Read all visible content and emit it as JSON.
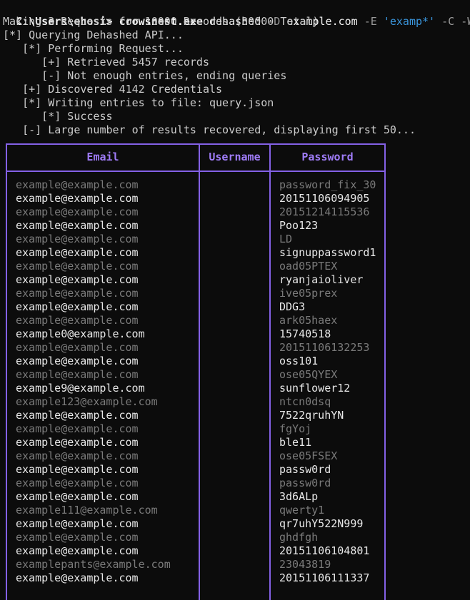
{
  "terminal": {
    "prompt": "C:\\Users\\ehosi>",
    "command": {
      "exe": "crowsnest.exe",
      "sub": "dehashed",
      "flag_d": "-D",
      "domain": "example.com",
      "flag_e": "-E",
      "query": "'examp*'",
      "flag_c": "-C",
      "flag_w": "-W"
    },
    "output": [
      "Making 3 Requests for 10000 Records (30000 Total)",
      "[*] Querying Dehashed API...",
      "   [*] Performing Request...",
      "      [+] Retrieved 5457 records",
      "      [-] Not enough entries, ending queries",
      "   [+] Discovered 4142 Credentials",
      "   [*] Writing entries to file: query.json",
      "      [*] Success",
      "   [-] Large number of results recovered, displaying first 50..."
    ]
  },
  "table": {
    "headers": [
      "Email",
      "Username",
      "Password"
    ],
    "border_color": "#8461e6",
    "header_color": "#9f7cf7",
    "rows": [
      {
        "email": "example@example.com",
        "username": "",
        "password": "password_fix_30",
        "style": "dim"
      },
      {
        "email": "example@example.com",
        "username": "",
        "password": "20151106094905",
        "style": "bright"
      },
      {
        "email": "example@example.com",
        "username": "",
        "password": "20151214115536",
        "style": "dim"
      },
      {
        "email": "example@example.com",
        "username": "",
        "password": "Poo123",
        "style": "bright"
      },
      {
        "email": "example@example.com",
        "username": "",
        "password": "LD",
        "style": "dim"
      },
      {
        "email": "example@example.com",
        "username": "",
        "password": "signuppassword1",
        "style": "bright"
      },
      {
        "email": "example@example.com",
        "username": "",
        "password": "oad05PTEX",
        "style": "dim"
      },
      {
        "email": "example@example.com",
        "username": "",
        "password": "ryanjaioliver",
        "style": "bright"
      },
      {
        "email": "example@example.com",
        "username": "",
        "password": "ive05prex",
        "style": "dim"
      },
      {
        "email": "example@example.com",
        "username": "",
        "password": "DDG3",
        "style": "bright"
      },
      {
        "email": "example@example.com",
        "username": "",
        "password": "ark05haex",
        "style": "dim"
      },
      {
        "email": "example0@example.com",
        "username": "",
        "password": "15740518",
        "style": "bright"
      },
      {
        "email": "example@example.com",
        "username": "",
        "password": "20151106132253",
        "style": "dim"
      },
      {
        "email": "example@example.com",
        "username": "",
        "password": "oss101",
        "style": "bright"
      },
      {
        "email": "example@example.com",
        "username": "",
        "password": "ose05QYEX",
        "style": "dim"
      },
      {
        "email": "example9@example.com",
        "username": "",
        "password": "sunflower12",
        "style": "bright"
      },
      {
        "email": "example123@example.com",
        "username": "",
        "password": "ntcn0dsq",
        "style": "dim"
      },
      {
        "email": "example@example.com",
        "username": "",
        "password": "7522qruhYN",
        "style": "bright"
      },
      {
        "email": "example@example.com",
        "username": "",
        "password": "fgYoj",
        "style": "dim"
      },
      {
        "email": "example@example.com",
        "username": "",
        "password": "ble11",
        "style": "bright"
      },
      {
        "email": "example@example.com",
        "username": "",
        "password": "ose05FSEX",
        "style": "dim"
      },
      {
        "email": "example@example.com",
        "username": "",
        "password": "passw0rd",
        "style": "bright"
      },
      {
        "email": "example@example.com",
        "username": "",
        "password": "passw0rd",
        "style": "dim"
      },
      {
        "email": "example@example.com",
        "username": "",
        "password": "3d6ALp",
        "style": "bright"
      },
      {
        "email": "example111@example.com",
        "username": "",
        "password": "qwerty1",
        "style": "dim"
      },
      {
        "email": "example@example.com",
        "username": "",
        "password": "qr7uhY522N999",
        "style": "bright"
      },
      {
        "email": "example@example.com",
        "username": "",
        "password": "ghdfgh",
        "style": "dim"
      },
      {
        "email": "example@example.com",
        "username": "",
        "password": "20151106104801",
        "style": "bright"
      },
      {
        "email": "examplepants@example.com",
        "username": "",
        "password": "23043819",
        "style": "dim"
      },
      {
        "email": "example@example.com",
        "username": "",
        "password": "20151106111337",
        "style": "bright"
      }
    ]
  }
}
